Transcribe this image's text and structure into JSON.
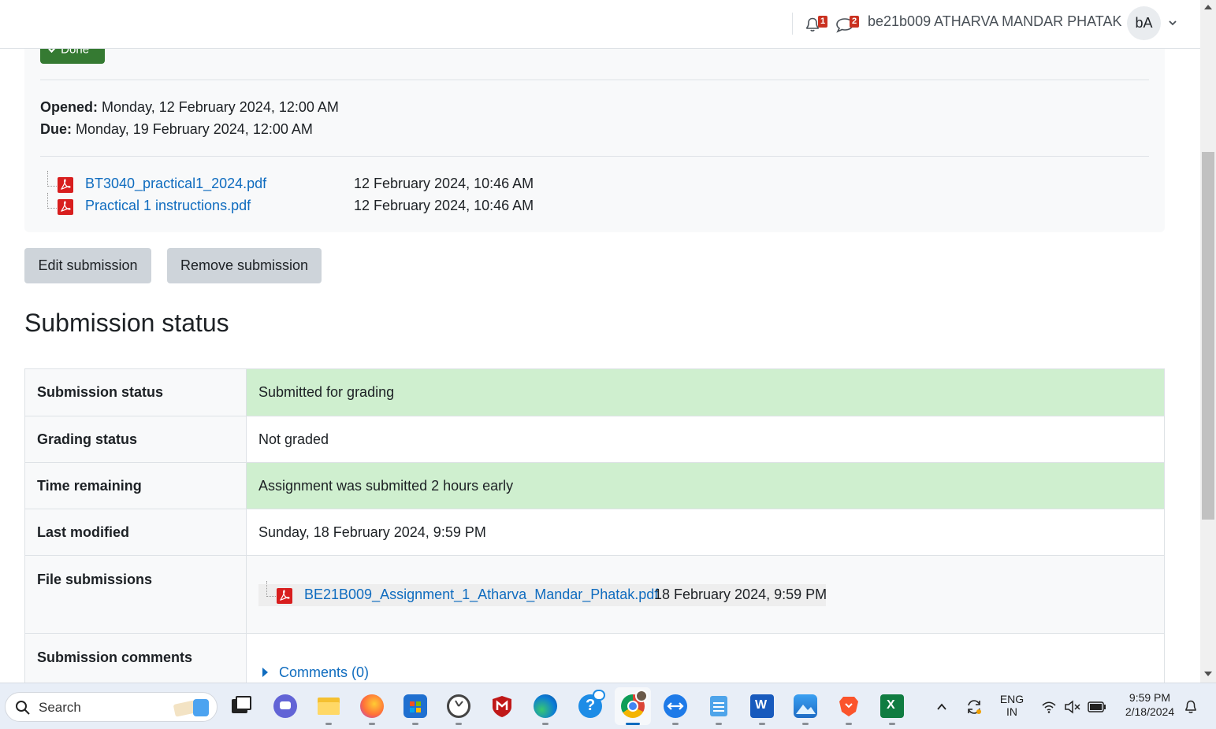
{
  "header": {
    "notification_count": "1",
    "message_count": "2",
    "user_name": "be21b009 ATHARVA MANDAR PHATAK",
    "avatar_initials": "bA"
  },
  "activity": {
    "done_label": "Done",
    "opened_label": "Opened:",
    "opened_value": "Monday, 12 February 2024, 12:00 AM",
    "due_label": "Due:",
    "due_value": "Monday, 19 February 2024, 12:00 AM",
    "files": [
      {
        "name": "BT3040_practical1_2024.pdf",
        "date": "12 February 2024, 10:46 AM"
      },
      {
        "name": "Practical 1 instructions.pdf",
        "date": "12 February 2024, 10:46 AM"
      }
    ]
  },
  "actions": {
    "edit_label": "Edit submission",
    "remove_label": "Remove submission"
  },
  "status": {
    "heading": "Submission status",
    "rows": [
      {
        "label": "Submission status",
        "value": "Submitted for grading"
      },
      {
        "label": "Grading status",
        "value": "Not graded"
      },
      {
        "label": "Time remaining",
        "value": "Assignment was submitted 2 hours early"
      },
      {
        "label": "Last modified",
        "value": "Sunday, 18 February 2024, 9:59 PM"
      },
      {
        "label": "File submissions",
        "value": ""
      },
      {
        "label": "Submission comments",
        "value": ""
      }
    ],
    "submitted_file": {
      "name": "BE21B009_Assignment_1_Atharva_Mandar_Phatak.pdf",
      "date": "18 February 2024, 9:59 PM"
    },
    "comments_link": "Comments (0)"
  },
  "colors": {
    "link": "#0f6cbf",
    "done_green": "#357a32",
    "status_green": "#cfefcf",
    "badge_red": "#ca3120"
  },
  "taskbar": {
    "search_label": "Search",
    "language_line1": "ENG",
    "language_line2": "IN",
    "time": "9:59 PM",
    "date": "2/18/2024",
    "apps": [
      "task-view-icon",
      "teams-chat-icon",
      "file-explorer-icon",
      "firefox-icon",
      "microsoft-store-icon",
      "clock-icon",
      "mcafee-icon",
      "edge-icon",
      "get-help-icon",
      "chrome-icon",
      "teamviewer-icon",
      "notepad-icon",
      "word-icon",
      "photos-icon",
      "brave-icon",
      "excel-icon"
    ]
  }
}
